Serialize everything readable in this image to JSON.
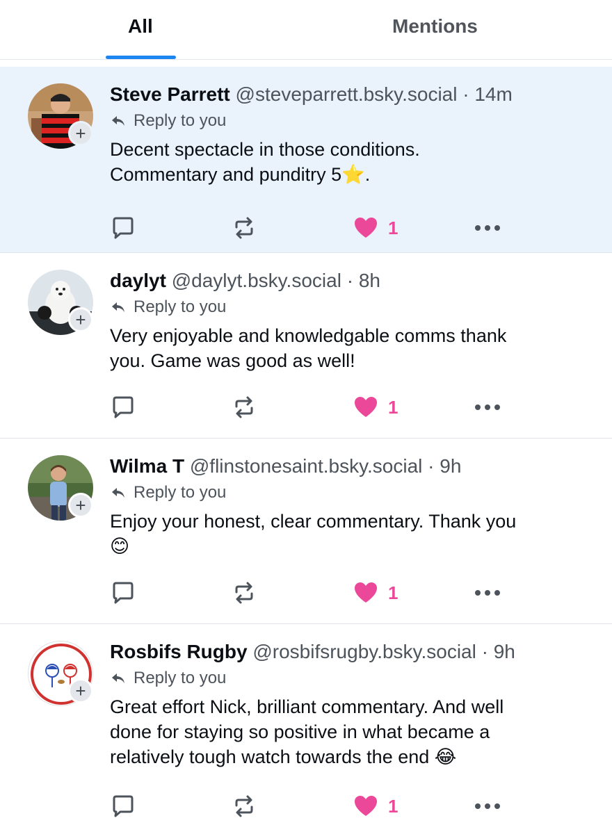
{
  "tabs": {
    "all": "All",
    "mentions": "Mentions",
    "active": "All"
  },
  "colors": {
    "accent": "#1d85f0",
    "like": "#ec4899",
    "highlight_bg": "#eaf2fc"
  },
  "posts": [
    {
      "display_name": "Steve Parrett",
      "handle": "@steveparrett.bsky.social",
      "separator": "·",
      "time": "14m",
      "reply_label": "Reply to you",
      "text": "Decent spectacle in those conditions.\nCommentary and punditry 5⭐.",
      "like_count": "1",
      "liked": true,
      "avatar_icon": "person-in-red-black-shirt-avatar"
    },
    {
      "display_name": "daylyt",
      "handle": "@daylyt.bsky.social",
      "separator": "·",
      "time": "8h",
      "reply_label": "Reply to you",
      "text": "Very enjoyable and knowledgable comms thank\nyou. Game was good as well!",
      "like_count": "1",
      "liked": true,
      "avatar_icon": "polar-bear-avatar"
    },
    {
      "display_name": "Wilma T",
      "handle": "@flinstonesaint.bsky.social",
      "separator": "·",
      "time": "9h",
      "reply_label": "Reply to you",
      "text": "Enjoy your honest, clear commentary. Thank you\n😊",
      "like_count": "1",
      "liked": true,
      "avatar_icon": "woman-outdoors-avatar"
    },
    {
      "display_name": "Rosbifs Rugby",
      "handle": "@rosbifsrugby.bsky.social",
      "separator": "·",
      "time": "9h",
      "reply_label": "Reply to you",
      "text": "Great effort Nick, brilliant commentary. And well\ndone for staying so positive in what became a\nrelatively tough watch towards the end 😂",
      "like_count": "1",
      "liked": true,
      "avatar_icon": "rosbifs-rugby-logo-avatar"
    }
  ]
}
